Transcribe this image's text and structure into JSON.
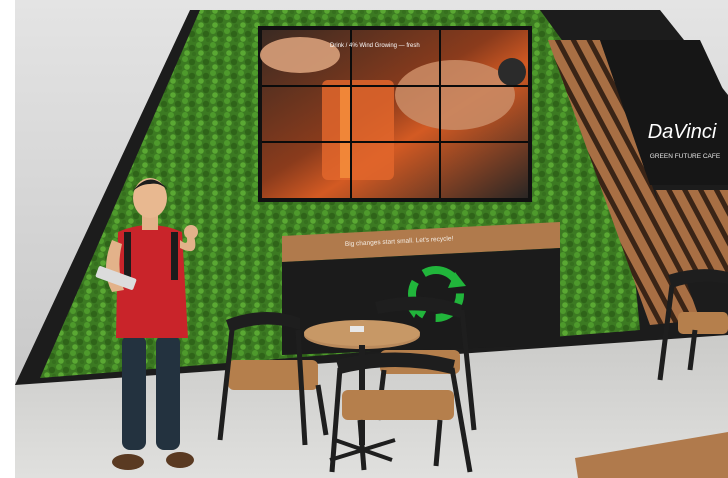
{
  "scene": {
    "video_wall_caption": "Drink / 4% Wind Growing — fresh",
    "counter_slogan": "Big changes start small. Let's recycle!",
    "brand_logo": "DaVinci",
    "brand_tagline": "GREEN FUTURE CAFE",
    "recycle_icon": "recycle-icon",
    "colors": {
      "moss": "#3f7d25",
      "moss_dark": "#285516",
      "counter_black": "#1b1b1b",
      "counter_top_wood": "#b07a4c",
      "slat_wood": "#a86f44",
      "recycle_green": "#21b53b",
      "shirt_red": "#c9242a",
      "floor": "#d8d8d6",
      "wall_grey": "#cfcfcf"
    }
  }
}
